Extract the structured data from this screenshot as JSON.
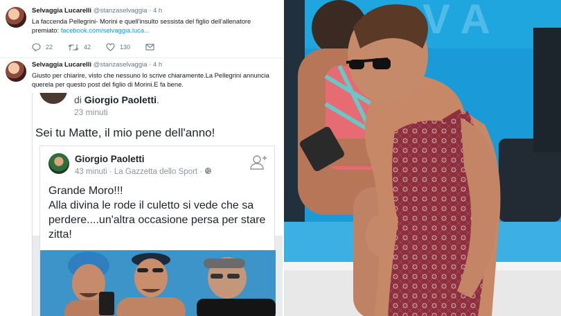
{
  "tweets": [
    {
      "name": "Selvaggia Lucarelli",
      "handle": "@stanzaselvaggia",
      "time": "· 4 h",
      "text": "La faccenda Pellegrini- Morini e quell'insulto sessista del figlio dell'allenatore premiato: ",
      "link": "facebook.com/selvaggia.luca...",
      "replies": "22",
      "retweets": "42",
      "likes": "130"
    },
    {
      "name": "Selvaggia Lucarelli",
      "handle": "@stanzaselvaggia",
      "time": "· 4 h",
      "text": "Giusto per chiarire, visto che nessuno lo scrive chiaramente.La Pellegrini annuncia querela per questo post del figlio di Morini.E fa bene."
    }
  ],
  "facebook": {
    "di": "di",
    "author": "Giorgio Paoletti",
    "time": "23 minuti",
    "post": "Sei tu Matte, il mio pene dell'anno!",
    "shared": {
      "author": "Giorgio Paoletti",
      "meta": "43 minuti · La Gazzetta dello Sport · ",
      "text_lines": [
        "Grande Moro!!!",
        "Alla divina le rode il culetto si vede che sa perdere....un'altra occasione persa per stare zitta!"
      ]
    }
  },
  "icons": {
    "reply": "reply-icon",
    "retweet": "retweet-icon",
    "like": "heart-icon",
    "message": "message-icon",
    "globe": "globe-icon",
    "add_friend": "add-friend-icon"
  },
  "colors": {
    "twitter_link": "#1b95e0",
    "pool_blue": "#1a9ad6",
    "swimsuit": "#8e2f3d"
  }
}
